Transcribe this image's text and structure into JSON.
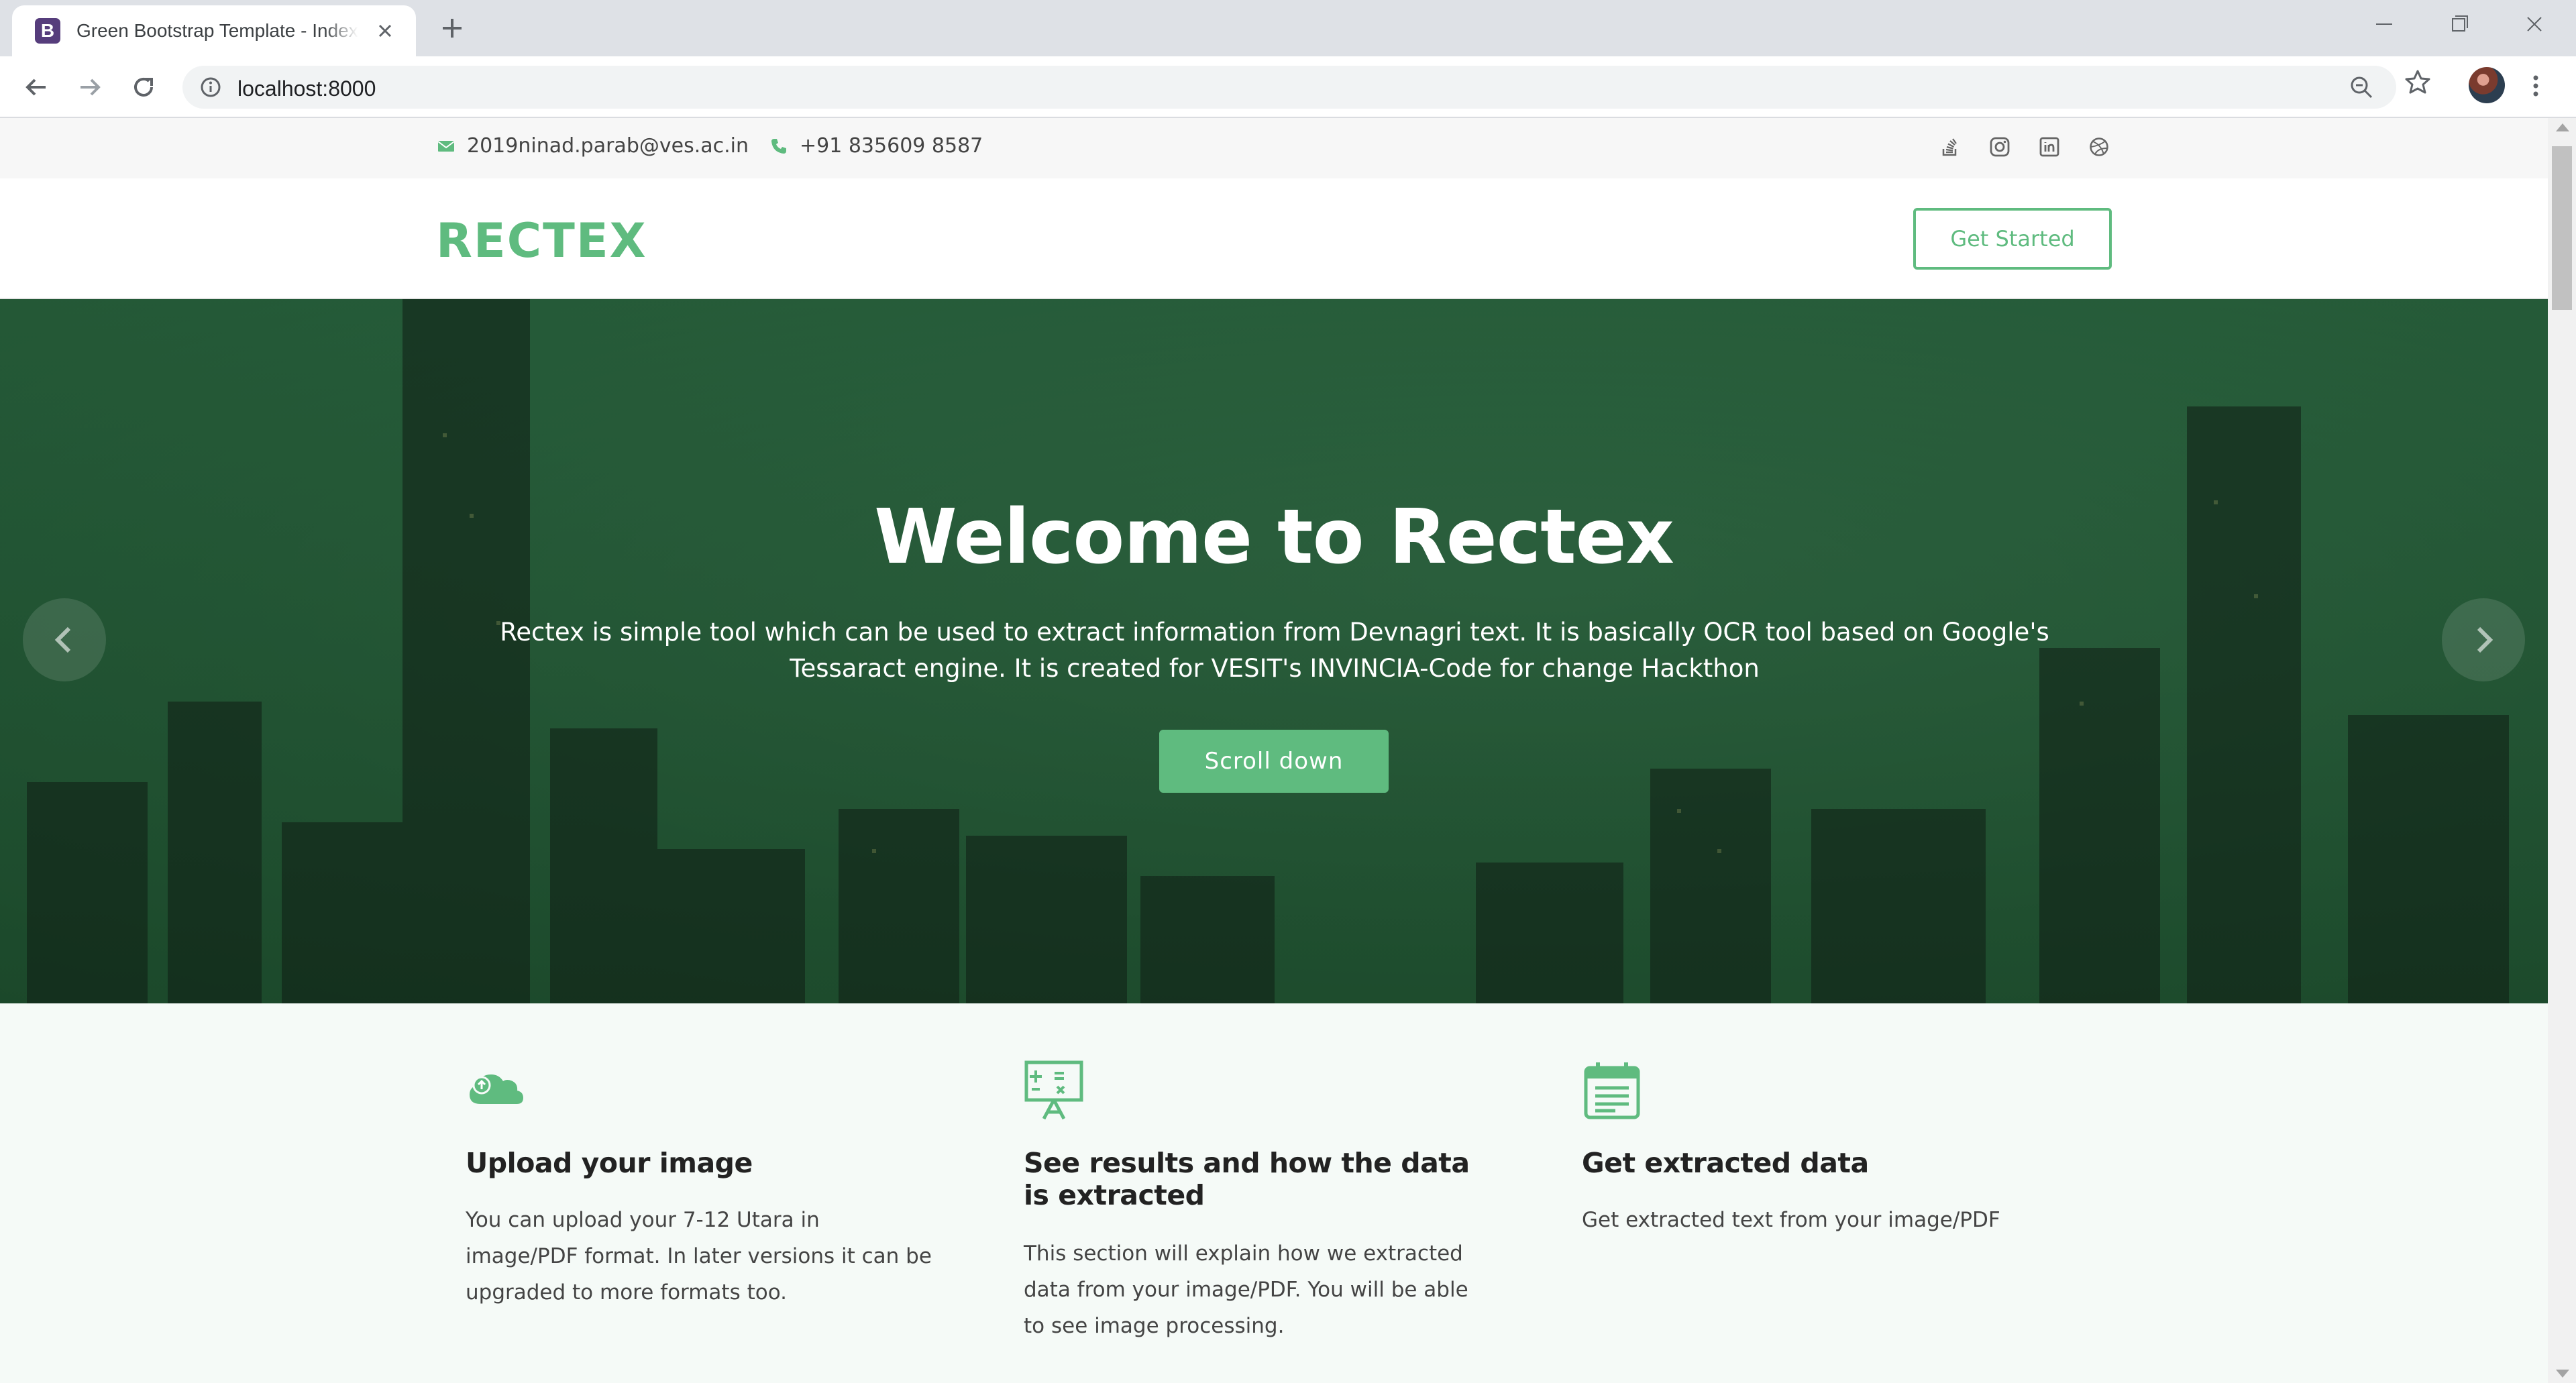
{
  "browser": {
    "tab_title": "Green Bootstrap Template - Index",
    "favicon_letter": "B",
    "url": "localhost:8000"
  },
  "topbar": {
    "email": "2019ninad.parab@ves.ac.in",
    "phone": "+91 835609 8587",
    "social_icons": [
      "stackoverflow-icon",
      "instagram-icon",
      "linkedin-icon",
      "dribbble-icon"
    ]
  },
  "header": {
    "logo": "RECTEX",
    "cta_label": "Get Started"
  },
  "hero": {
    "title": "Welcome to Rectex",
    "text": "Rectex is simple tool which can be used to extract information from Devnagri text. It is basically OCR tool based on Google's Tessaract engine. It is created for VESIT's INVINCIA-Code for change Hackthon",
    "button_label": "Scroll down",
    "slide_count": 1,
    "active_slide": 1
  },
  "features": [
    {
      "icon": "cloud-upload-icon",
      "title": "Upload your image",
      "description": "You can upload your 7-12 Utara in image/PDF format. In later versions it can be upgraded to more formats too."
    },
    {
      "icon": "calculator-board-icon",
      "title": "See results and how the data is extracted",
      "description": "This section will explain how we extracted data from your image/PDF. You will be able to see image processing."
    },
    {
      "icon": "calendar-list-icon",
      "title": "Get extracted data",
      "description": "Get extracted text from your image/PDF"
    }
  ],
  "colors": {
    "accent": "#5fbb7f",
    "hero_overlay": "#2e7d4f",
    "features_bg": "#f5faf7"
  }
}
